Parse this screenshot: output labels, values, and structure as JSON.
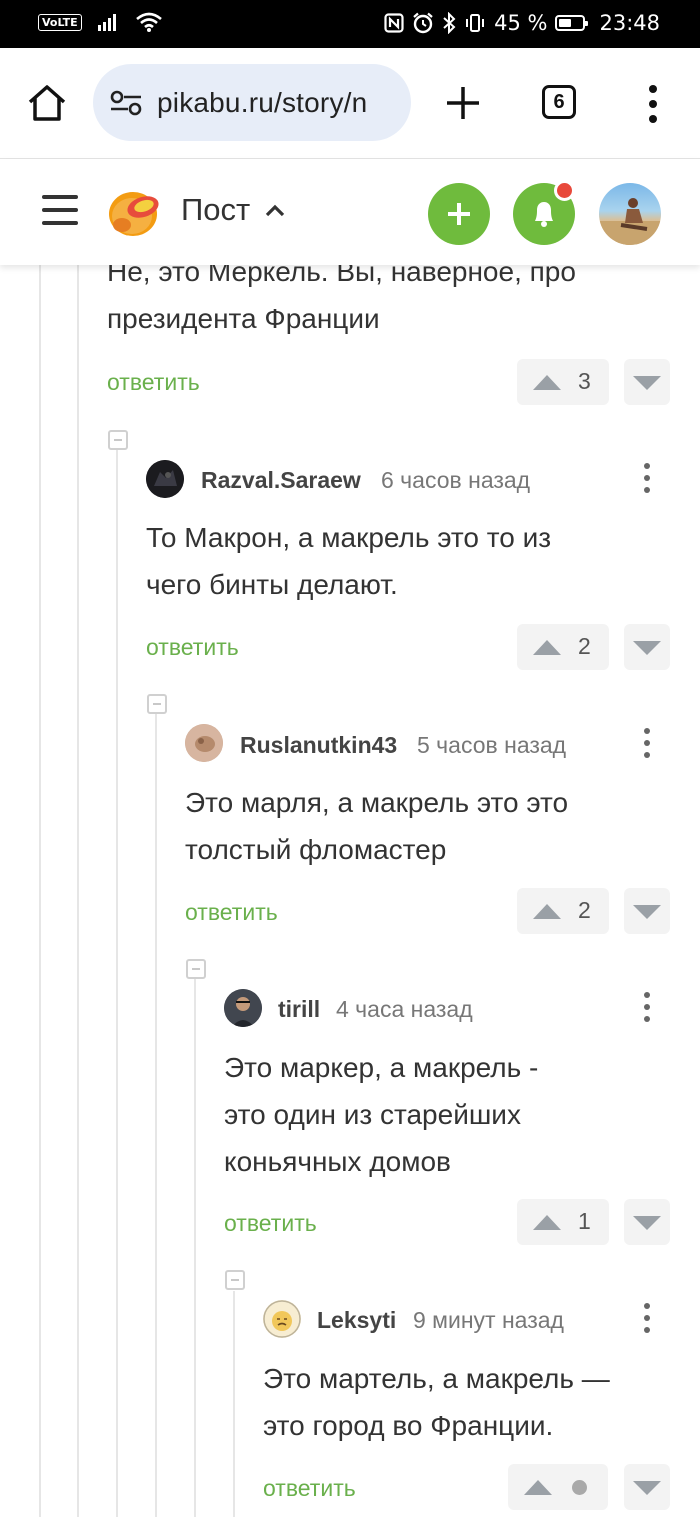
{
  "status_bar": {
    "volte": "VoLTE",
    "battery_percent": "45 %",
    "time": "23:48"
  },
  "browser": {
    "url": "pikabu.ru/story/n",
    "tab_count": "6"
  },
  "app_header": {
    "title": "Пост"
  },
  "colors": {
    "accent_green": "#6fbb3d",
    "reply_green": "#6ab04c",
    "notification_red": "#e8493b"
  },
  "comments": [
    {
      "text_lines": [
        "Не, это Меркель. Вы, наверное, про",
        "президента Франции"
      ],
      "reply_label": "ответить",
      "votes": "3"
    },
    {
      "username": "Razval.Saraew",
      "time": "6 часов назад",
      "text_lines": [
        "То Макрон, а макрель это то из",
        "чего бинты делают."
      ],
      "reply_label": "ответить",
      "votes": "2"
    },
    {
      "username": "Ruslanutkin43",
      "time": "5 часов назад",
      "text_lines": [
        "Это марля, а макрель это это",
        "толстый фломастер"
      ],
      "reply_label": "ответить",
      "votes": "2"
    },
    {
      "username": "tirill",
      "time": "4 часа назад",
      "text_lines": [
        "Это маркер, а макрель -",
        "это один из старейших",
        "коньячных домов"
      ],
      "reply_label": "ответить",
      "votes": "1"
    },
    {
      "username": "Leksyti",
      "time": "9 минут назад",
      "text_lines": [
        "Это мартель, а макрель —",
        "это город во Франции."
      ],
      "reply_label": "ответить",
      "votes": "",
      "icons": [
        "upvote-icon",
        "rating-hidden-dot-icon",
        "downvote-icon"
      ]
    }
  ]
}
